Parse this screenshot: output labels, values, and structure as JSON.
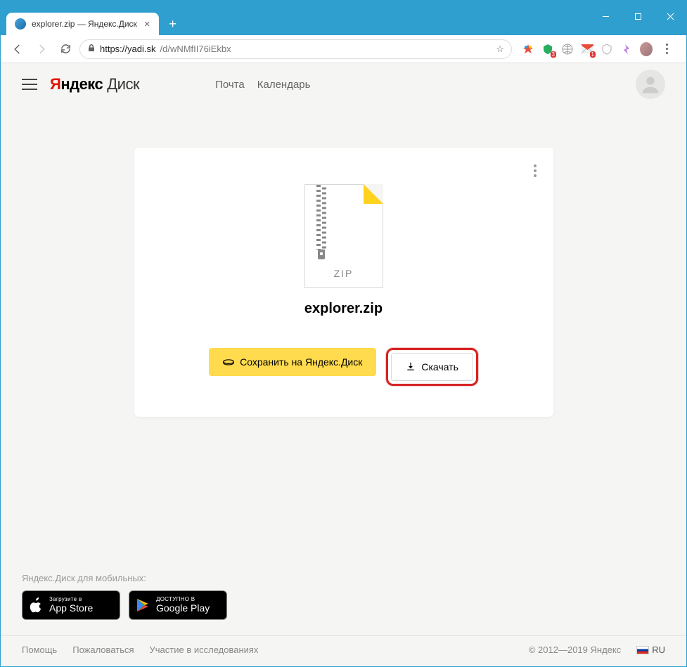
{
  "browser": {
    "tab_title": "explorer.zip — Яндекс.Диск",
    "url_host": "https://yadi.sk",
    "url_path": "/d/wNMfII76iEkbx",
    "extension_badges": {
      "green": "3",
      "red": "1"
    }
  },
  "header": {
    "logo_y": "Я",
    "logo_rest": "ндекс",
    "logo_disk": "Диск",
    "links": {
      "mail": "Почта",
      "calendar": "Календарь"
    }
  },
  "file": {
    "ext_label": "ZIP",
    "name": "explorer.zip"
  },
  "actions": {
    "save": "Сохранить на Яндекс.Диск",
    "download": "Скачать"
  },
  "footer": {
    "mobile_caption": "Яндекс.Диск для мобильных:",
    "appstore": {
      "small": "Загрузите в",
      "big": "App Store"
    },
    "googleplay": {
      "small": "ДОСТУПНО В",
      "big": "Google Play"
    },
    "links": {
      "help": "Помощь",
      "report": "Пожаловаться",
      "research": "Участие в исследованиях"
    },
    "copyright": "© 2012—2019 Яндекс",
    "lang": "RU"
  }
}
